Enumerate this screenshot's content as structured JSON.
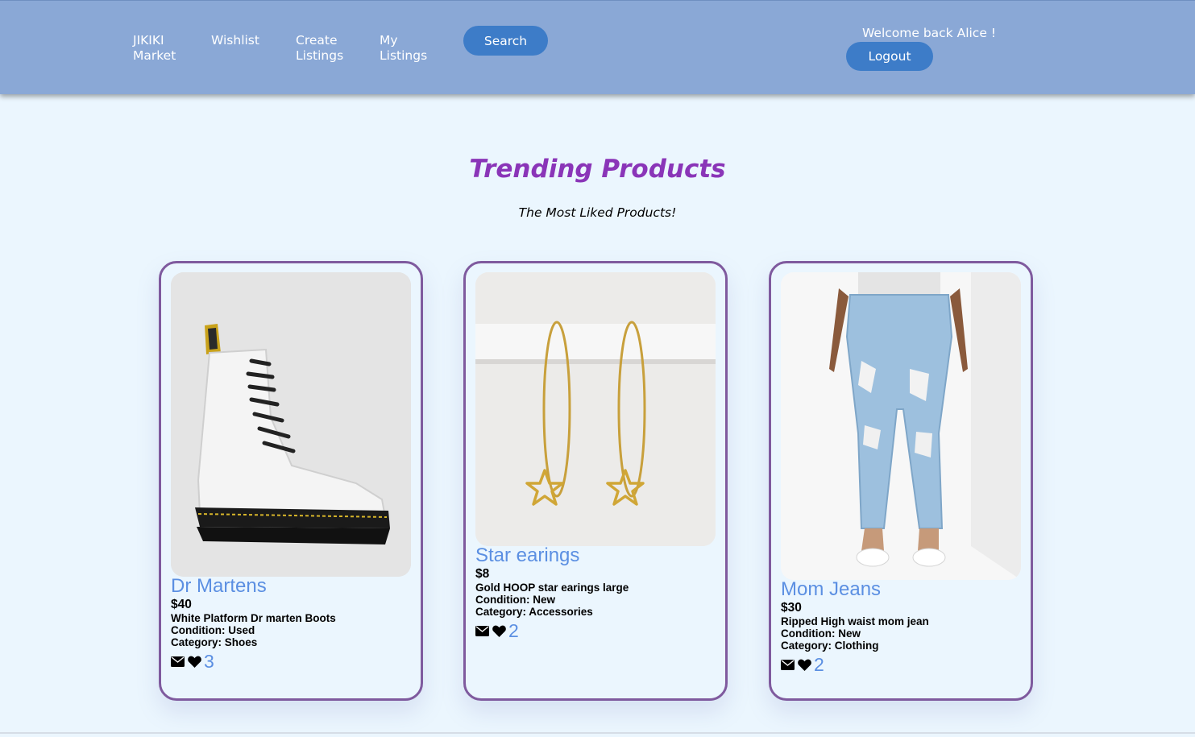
{
  "nav": {
    "brand": "JIKIKI\nMarket",
    "wishlist": "Wishlist",
    "create": "Create\nListings",
    "my": "My\nListings",
    "search_button": "Search",
    "welcome": "Welcome back Alice !",
    "logout_button": "Logout"
  },
  "page": {
    "title": "Trending Products",
    "subtitle": "The Most Liked Products!"
  },
  "products": [
    {
      "name": "Dr Martens",
      "price": "$40",
      "description": "White Platform Dr marten Boots",
      "condition": "Condition: Used",
      "category": "Category: Shoes",
      "likes": "3",
      "image_icon": "boot-icon"
    },
    {
      "name": "Star earings",
      "price": "$8",
      "description": "Gold HOOP star earings large",
      "condition": "Condition: New",
      "category": "Category: Accessories",
      "likes": "2",
      "image_icon": "earrings-icon"
    },
    {
      "name": "Mom Jeans",
      "price": "$30",
      "description": "Ripped High waist mom jean",
      "condition": "Condition: New",
      "category": "Category: Clothing",
      "likes": "2",
      "image_icon": "jeans-icon"
    }
  ],
  "colors": {
    "navbar": "#8aa8d6",
    "button": "#3d7cc8",
    "background": "#ebf6fe",
    "title": "#8a35b8",
    "card_border": "#7f5a9e",
    "product_name": "#5b8fe2"
  }
}
